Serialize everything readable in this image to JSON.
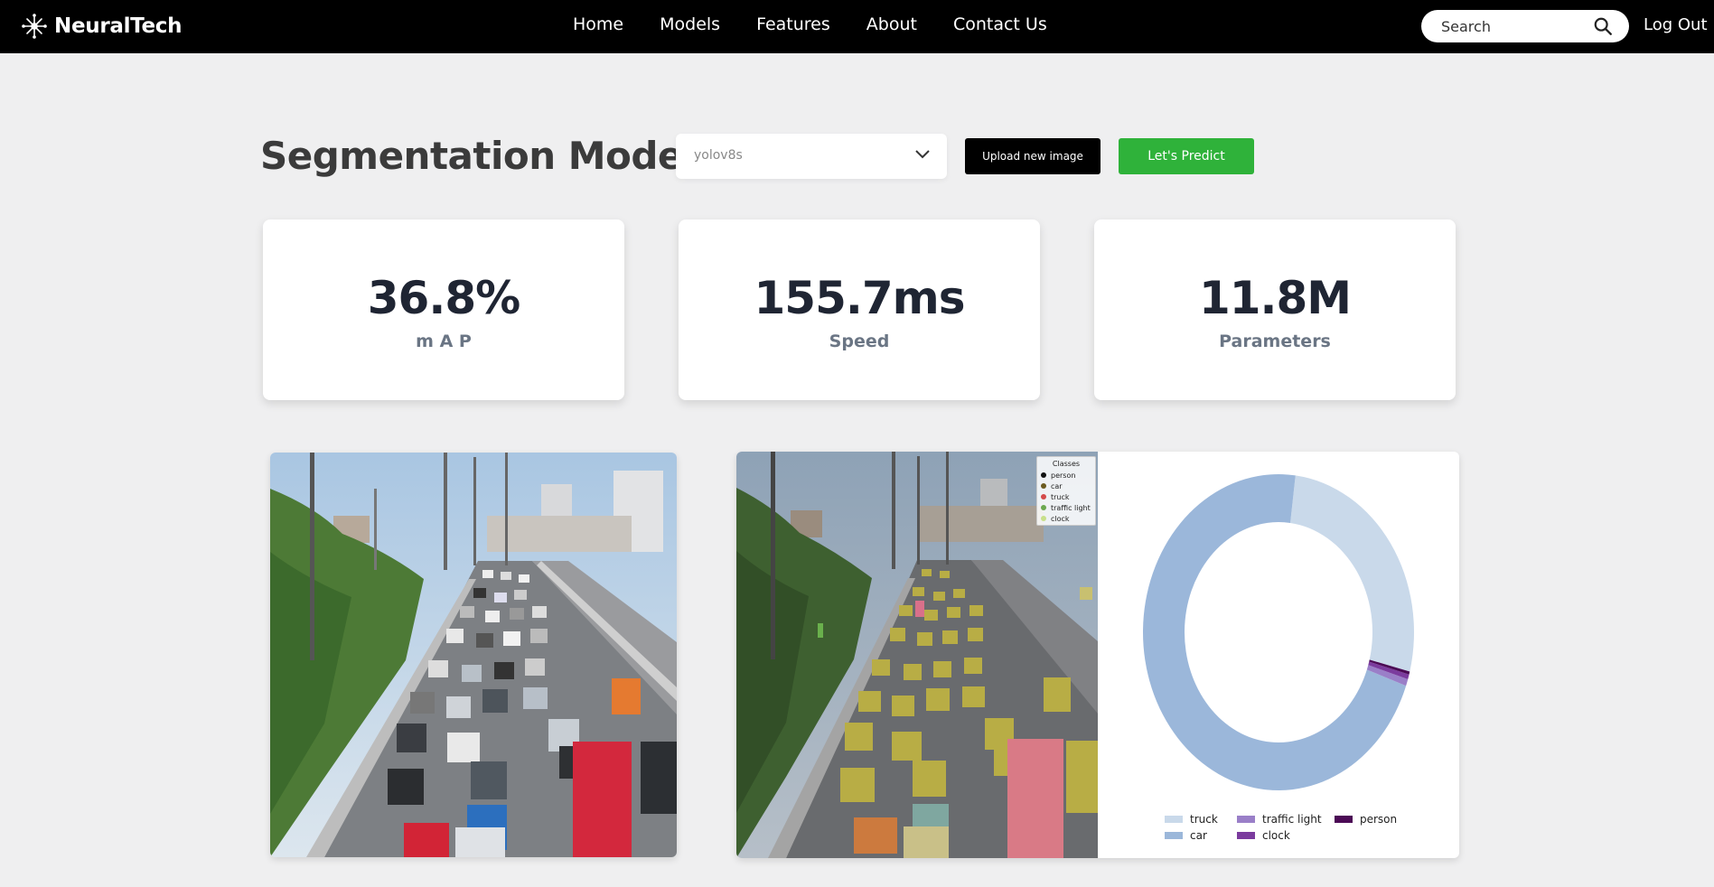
{
  "nav": {
    "brand": "NeuralTech",
    "links": [
      "Home",
      "Models",
      "Features",
      "About",
      "Contact Us"
    ],
    "search_placeholder": "Search",
    "logout": "Log Out"
  },
  "header": {
    "title": "Segmentation Model",
    "model_selected": "yolov8s",
    "upload_label": "Upload new image",
    "predict_label": "Let's Predict"
  },
  "stats": [
    {
      "value": "36.8%",
      "label": "m A P"
    },
    {
      "value": "155.7ms",
      "label": "Speed"
    },
    {
      "value": "11.8M",
      "label": "Parameters"
    }
  ],
  "classes_legend": {
    "title": "Classes",
    "items": [
      {
        "label": "person",
        "color": "#111111"
      },
      {
        "label": "car",
        "color": "#6b5a1e"
      },
      {
        "label": "truck",
        "color": "#d44a4a"
      },
      {
        "label": "traffic light",
        "color": "#6aa84f"
      },
      {
        "label": "clock",
        "color": "#c8e08a"
      }
    ]
  },
  "chart_data": {
    "type": "pie",
    "donut": true,
    "labels": [
      "truck",
      "car",
      "traffic light",
      "clock",
      "person"
    ],
    "values": [
      27.0,
      71.5,
      0.7,
      0.5,
      0.3
    ],
    "colors": [
      "#c9d9ea",
      "#9bb7da",
      "#9a7fc8",
      "#7b3b9e",
      "#4b0a55"
    ],
    "legend": [
      "truck",
      "car",
      "traffic light",
      "clock",
      "person"
    ],
    "legend_position": "bottom"
  },
  "colors": {
    "accent_green": "#2fb23a",
    "navbar": "#000000"
  }
}
